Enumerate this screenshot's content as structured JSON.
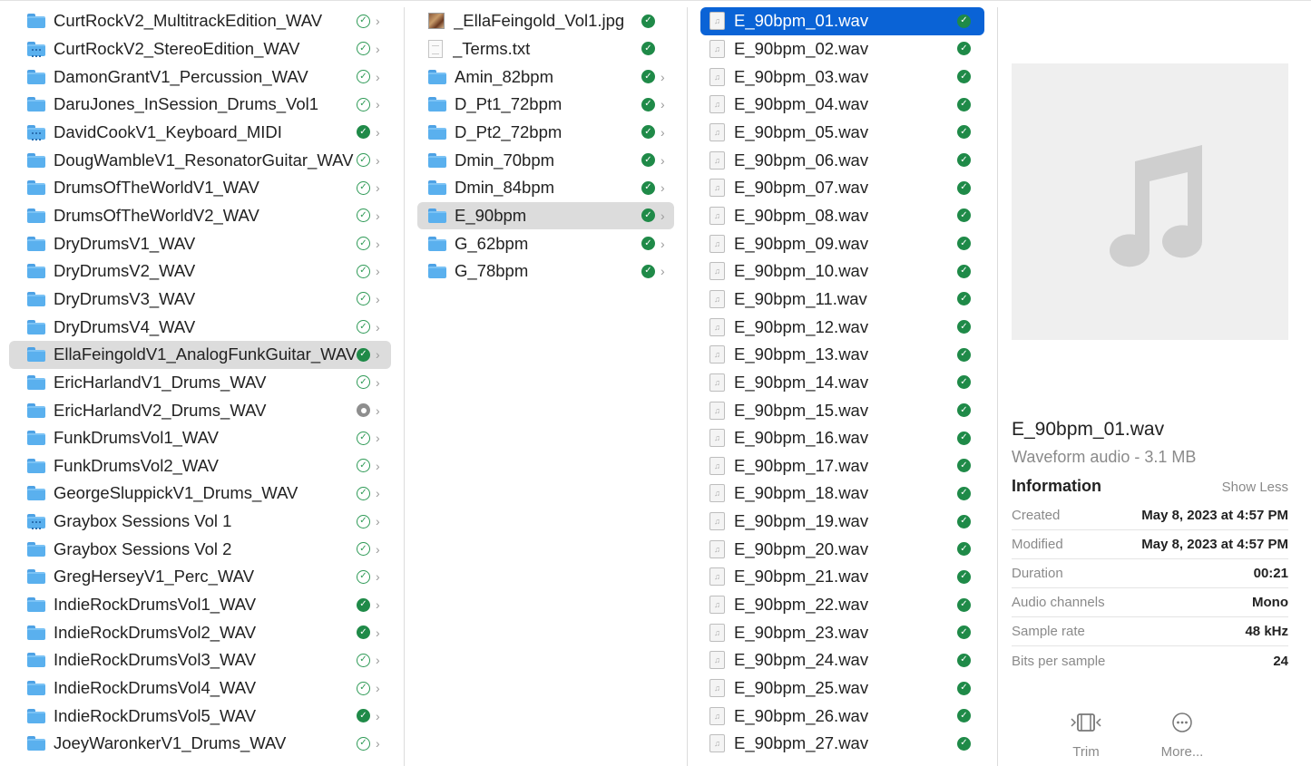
{
  "column1": {
    "items": [
      {
        "label": "CurtRockV2_MultitrackEdition_WAV",
        "status": "outline",
        "special": false
      },
      {
        "label": "CurtRockV2_StereoEdition_WAV",
        "status": "outline",
        "special": true
      },
      {
        "label": "DamonGrantV1_Percussion_WAV",
        "status": "outline",
        "special": false
      },
      {
        "label": "DaruJones_InSession_Drums_Vol1",
        "status": "outline",
        "special": false
      },
      {
        "label": "DavidCookV1_Keyboard_MIDI",
        "status": "filled",
        "special": true
      },
      {
        "label": "DougWambleV1_ResonatorGuitar_WAV",
        "status": "outline",
        "special": false
      },
      {
        "label": "DrumsOfTheWorldV1_WAV",
        "status": "outline",
        "special": false
      },
      {
        "label": "DrumsOfTheWorldV2_WAV",
        "status": "outline",
        "special": false
      },
      {
        "label": "DryDrumsV1_WAV",
        "status": "outline",
        "special": false
      },
      {
        "label": "DryDrumsV2_WAV",
        "status": "outline",
        "special": false
      },
      {
        "label": "DryDrumsV3_WAV",
        "status": "outline",
        "special": false
      },
      {
        "label": "DryDrumsV4_WAV",
        "status": "outline",
        "special": false
      },
      {
        "label": "EllaFeingoldV1_AnalogFunkGuitar_WAV",
        "status": "filled",
        "special": false,
        "selected": true
      },
      {
        "label": "EricHarlandV1_Drums_WAV",
        "status": "outline",
        "special": false
      },
      {
        "label": "EricHarlandV2_Drums_WAV",
        "status": "pending",
        "special": false
      },
      {
        "label": "FunkDrumsVol1_WAV",
        "status": "outline",
        "special": false
      },
      {
        "label": "FunkDrumsVol2_WAV",
        "status": "outline",
        "special": false
      },
      {
        "label": "GeorgeSluppickV1_Drums_WAV",
        "status": "outline",
        "special": false
      },
      {
        "label": "Graybox Sessions Vol 1",
        "status": "outline",
        "special": true
      },
      {
        "label": "Graybox Sessions Vol 2",
        "status": "outline",
        "special": false
      },
      {
        "label": "GregHerseyV1_Perc_WAV",
        "status": "outline",
        "special": false
      },
      {
        "label": "IndieRockDrumsVol1_WAV",
        "status": "filled",
        "special": false
      },
      {
        "label": "IndieRockDrumsVol2_WAV",
        "status": "filled",
        "special": false
      },
      {
        "label": "IndieRockDrumsVol3_WAV",
        "status": "outline",
        "special": false
      },
      {
        "label": "IndieRockDrumsVol4_WAV",
        "status": "outline",
        "special": false
      },
      {
        "label": "IndieRockDrumsVol5_WAV",
        "status": "filled",
        "special": false
      },
      {
        "label": "JoeyWaronkerV1_Drums_WAV",
        "status": "outline",
        "special": false
      }
    ]
  },
  "column2": {
    "items": [
      {
        "label": "_EllaFeingold_Vol1.jpg",
        "kind": "image",
        "status": "filled"
      },
      {
        "label": "_Terms.txt",
        "kind": "text",
        "status": "filled"
      },
      {
        "label": "Amin_82bpm",
        "kind": "folder",
        "status": "filled"
      },
      {
        "label": "D_Pt1_72bpm",
        "kind": "folder",
        "status": "filled"
      },
      {
        "label": "D_Pt2_72bpm",
        "kind": "folder",
        "status": "filled"
      },
      {
        "label": "Dmin_70bpm",
        "kind": "folder",
        "status": "filled"
      },
      {
        "label": "Dmin_84bpm",
        "kind": "folder",
        "status": "filled"
      },
      {
        "label": "E_90bpm",
        "kind": "folder",
        "status": "filled",
        "selected": true
      },
      {
        "label": "G_62bpm",
        "kind": "folder",
        "status": "filled"
      },
      {
        "label": "G_78bpm",
        "kind": "folder",
        "status": "filled"
      }
    ]
  },
  "column3": {
    "items": [
      "E_90bpm_01.wav",
      "E_90bpm_02.wav",
      "E_90bpm_03.wav",
      "E_90bpm_04.wav",
      "E_90bpm_05.wav",
      "E_90bpm_06.wav",
      "E_90bpm_07.wav",
      "E_90bpm_08.wav",
      "E_90bpm_09.wav",
      "E_90bpm_10.wav",
      "E_90bpm_11.wav",
      "E_90bpm_12.wav",
      "E_90bpm_13.wav",
      "E_90bpm_14.wav",
      "E_90bpm_15.wav",
      "E_90bpm_16.wav",
      "E_90bpm_17.wav",
      "E_90bpm_18.wav",
      "E_90bpm_19.wav",
      "E_90bpm_20.wav",
      "E_90bpm_21.wav",
      "E_90bpm_22.wav",
      "E_90bpm_23.wav",
      "E_90bpm_24.wav",
      "E_90bpm_25.wav",
      "E_90bpm_26.wav",
      "E_90bpm_27.wav"
    ],
    "active_index": 0
  },
  "preview": {
    "file_name": "E_90bpm_01.wav",
    "kind": "Waveform audio - 3.1 MB",
    "info_title": "Information",
    "show_less": "Show Less",
    "info": [
      {
        "key": "Created",
        "value": "May 8, 2023 at 4:57 PM"
      },
      {
        "key": "Modified",
        "value": "May 8, 2023 at 4:57 PM"
      },
      {
        "key": "Duration",
        "value": "00:21"
      },
      {
        "key": "Audio channels",
        "value": "Mono"
      },
      {
        "key": "Sample rate",
        "value": "48 kHz"
      },
      {
        "key": "Bits per sample",
        "value": "24"
      }
    ],
    "actions": [
      {
        "label": "Trim",
        "icon": "trim-icon"
      },
      {
        "label": "More...",
        "icon": "more-icon"
      }
    ]
  },
  "colors": {
    "selection_active": "#0a63d6",
    "selection_inactive": "#dcdcdc",
    "folder": "#5ab0ee",
    "synced": "#1f8a48"
  }
}
